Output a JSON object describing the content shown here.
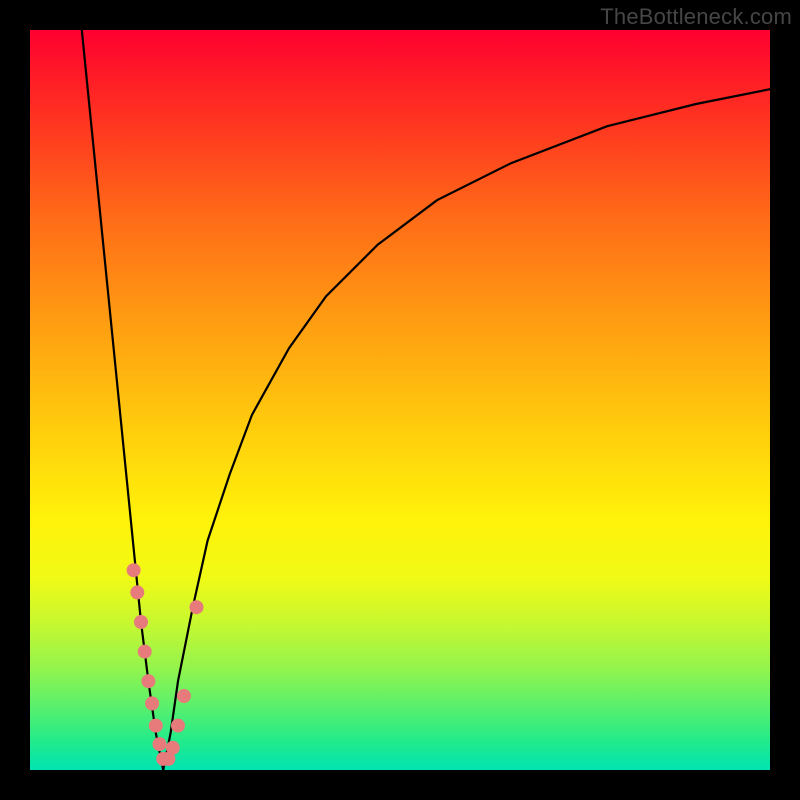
{
  "watermark": "TheBottleneck.com",
  "colors": {
    "frame": "#000000",
    "curve": "#000000",
    "marker": "#e77b7c",
    "gradient_top": "#ff0030",
    "gradient_bottom": "#00e3b2"
  },
  "chart_data": {
    "type": "line",
    "title": "",
    "xlabel": "",
    "ylabel": "",
    "xlim": [
      0,
      100
    ],
    "ylim": [
      0,
      100
    ],
    "note": "Axes are implicit (no tick labels shown). x≈relative hardware score, y≈bottleneck %. Values estimated from pixel positions; minimum of curve near x≈18, y≈0.",
    "series": [
      {
        "name": "left-branch",
        "x": [
          7,
          8,
          9,
          10,
          11,
          12,
          13,
          14,
          15,
          16,
          17,
          18
        ],
        "y": [
          100,
          90,
          80,
          70,
          60,
          50,
          40,
          30,
          20,
          12,
          5,
          0
        ]
      },
      {
        "name": "right-branch",
        "x": [
          18,
          19,
          20,
          22,
          24,
          27,
          30,
          35,
          40,
          47,
          55,
          65,
          78,
          90,
          100
        ],
        "y": [
          0,
          5,
          12,
          22,
          31,
          40,
          48,
          57,
          64,
          71,
          77,
          82,
          87,
          90,
          92
        ]
      }
    ],
    "markers": {
      "name": "highlighted-points",
      "comment": "salmon dots clustered near the curve minimum",
      "points": [
        {
          "x": 14.0,
          "y": 27
        },
        {
          "x": 14.5,
          "y": 24
        },
        {
          "x": 15.0,
          "y": 20
        },
        {
          "x": 15.5,
          "y": 16
        },
        {
          "x": 16.0,
          "y": 12
        },
        {
          "x": 16.5,
          "y": 9
        },
        {
          "x": 17.0,
          "y": 6
        },
        {
          "x": 17.5,
          "y": 3.5
        },
        {
          "x": 18.0,
          "y": 1.5
        },
        {
          "x": 18.7,
          "y": 1.5
        },
        {
          "x": 19.3,
          "y": 3
        },
        {
          "x": 20.0,
          "y": 6
        },
        {
          "x": 20.8,
          "y": 10
        },
        {
          "x": 22.5,
          "y": 22
        }
      ]
    }
  }
}
